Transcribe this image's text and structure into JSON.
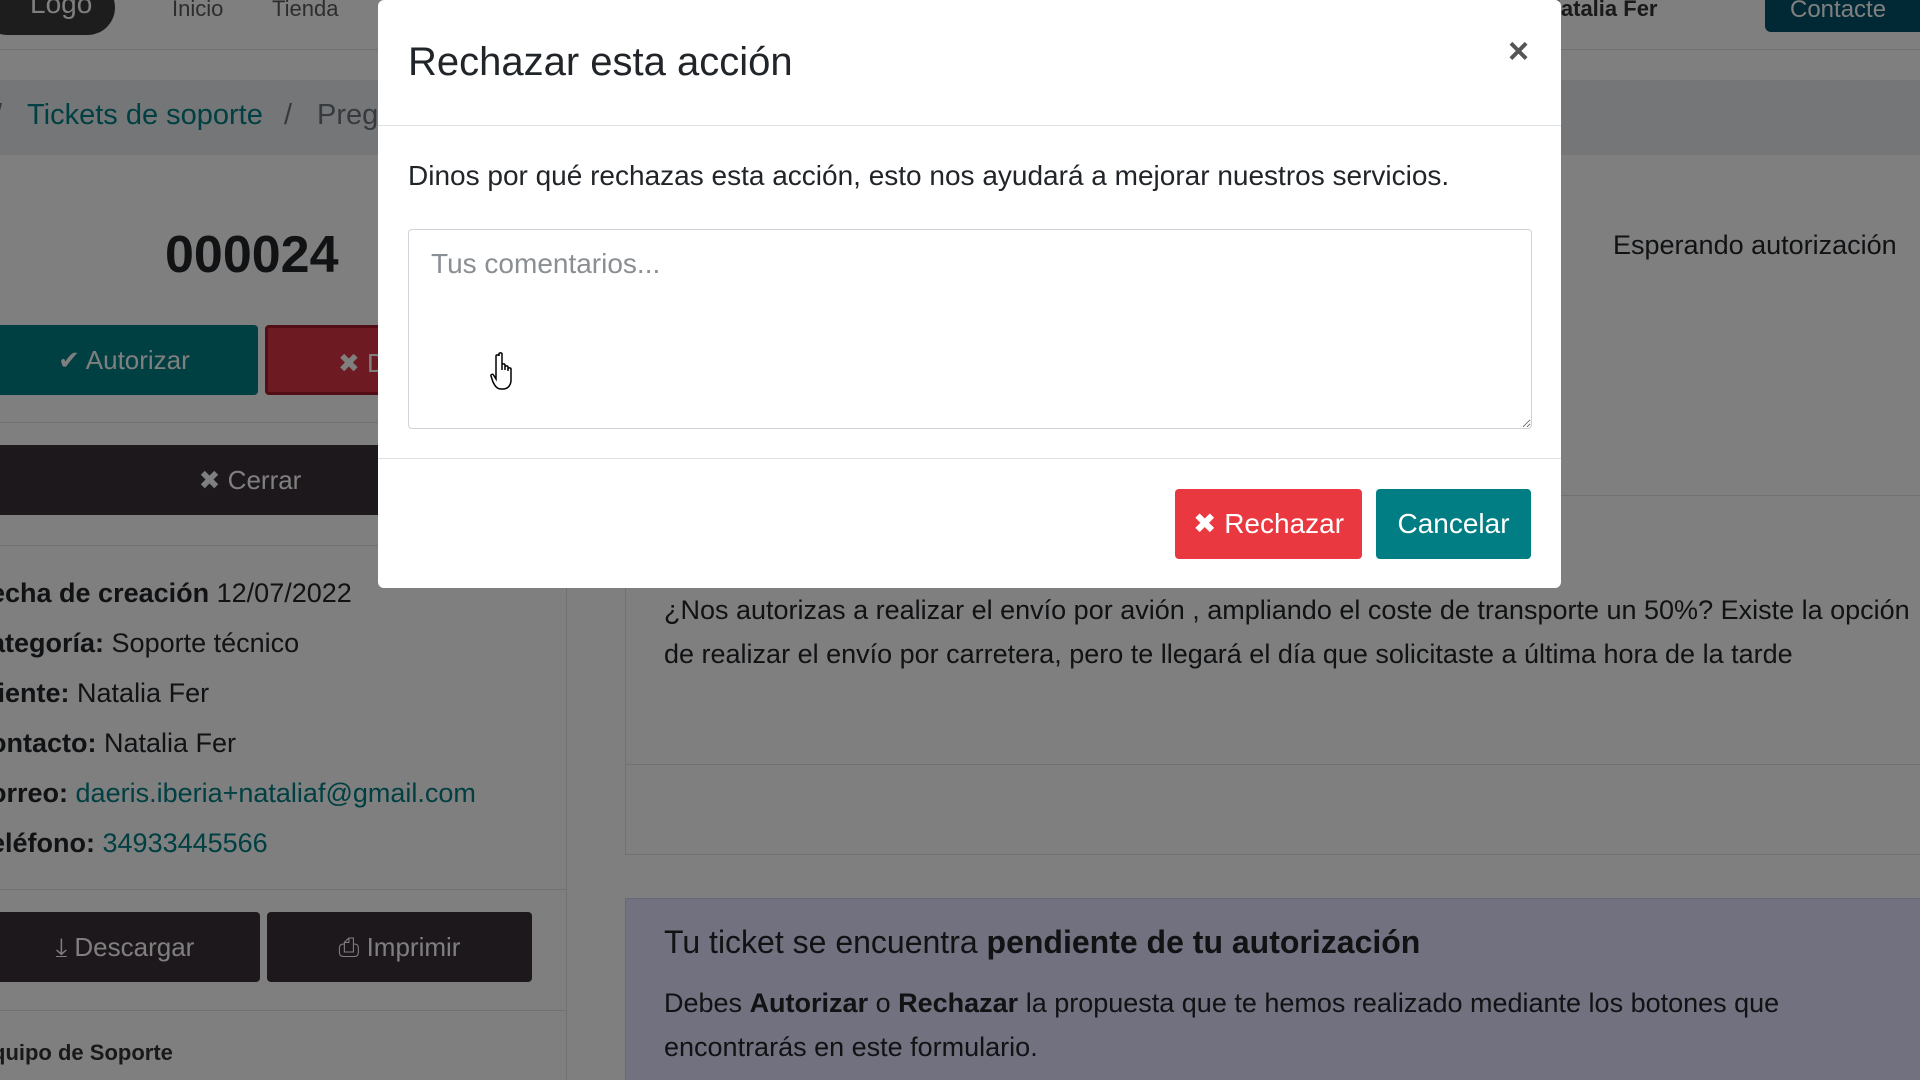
{
  "nav": {
    "logo": "Logo",
    "links": [
      "Inicio",
      "Tienda"
    ],
    "user": "Natalia Fer",
    "contact": "Contacte"
  },
  "breadcrumb": {
    "items": [
      "Tickets de soporte",
      "Preg"
    ]
  },
  "ticket": {
    "number": "000024",
    "authorize_label": "Autorizar",
    "deny_label": "D",
    "close_label": "Cerrar",
    "status": "Esperando autorización",
    "info": {
      "created_label": "echa de creación",
      "created_value": "12/07/2022",
      "category_label": "ategoría:",
      "category_value": "Soporte técnico",
      "client_label": "liente:",
      "client_value": "Natalia Fer",
      "contact_label": "ontacto:",
      "contact_value": "Natalia Fer",
      "email_label": "orreo:",
      "email_value": "daeris.iberia+nataliaf@gmail.com",
      "phone_label": "eléfono:",
      "phone_value": "34933445566"
    },
    "download_label": "Descargar",
    "print_label": "Imprimir",
    "team_label": "quipo de Soporte"
  },
  "question": {
    "text": "¿Nos autorizas a realizar el envío por avión , ampliando el coste de transporte un 50%? Existe la opción de realizar el envío por carretera, pero te llegará el día que solicitaste a última hora de la tarde"
  },
  "pending": {
    "title_prefix": "Tu ticket se encuentra ",
    "title_bold": "pendiente de tu autorización",
    "body_1": "Debes ",
    "body_authorize": "Autorizar",
    "body_2": " o ",
    "body_reject": "Rechazar",
    "body_3": " la propuesta que te hemos realizado mediante los botones que encontrarás en este formulario."
  },
  "modal": {
    "title": "Rechazar esta acción",
    "close_symbol": "×",
    "description": "Dinos por qué rechazas esta acción, esto nos ayudará a mejorar nuestros servicios.",
    "textarea_placeholder": "Tus comentarios...",
    "reject_label": "Rechazar",
    "cancel_label": "Cancelar"
  },
  "colors": {
    "primary": "#017e84",
    "danger": "#e9383f",
    "dark": "#3b3136"
  }
}
